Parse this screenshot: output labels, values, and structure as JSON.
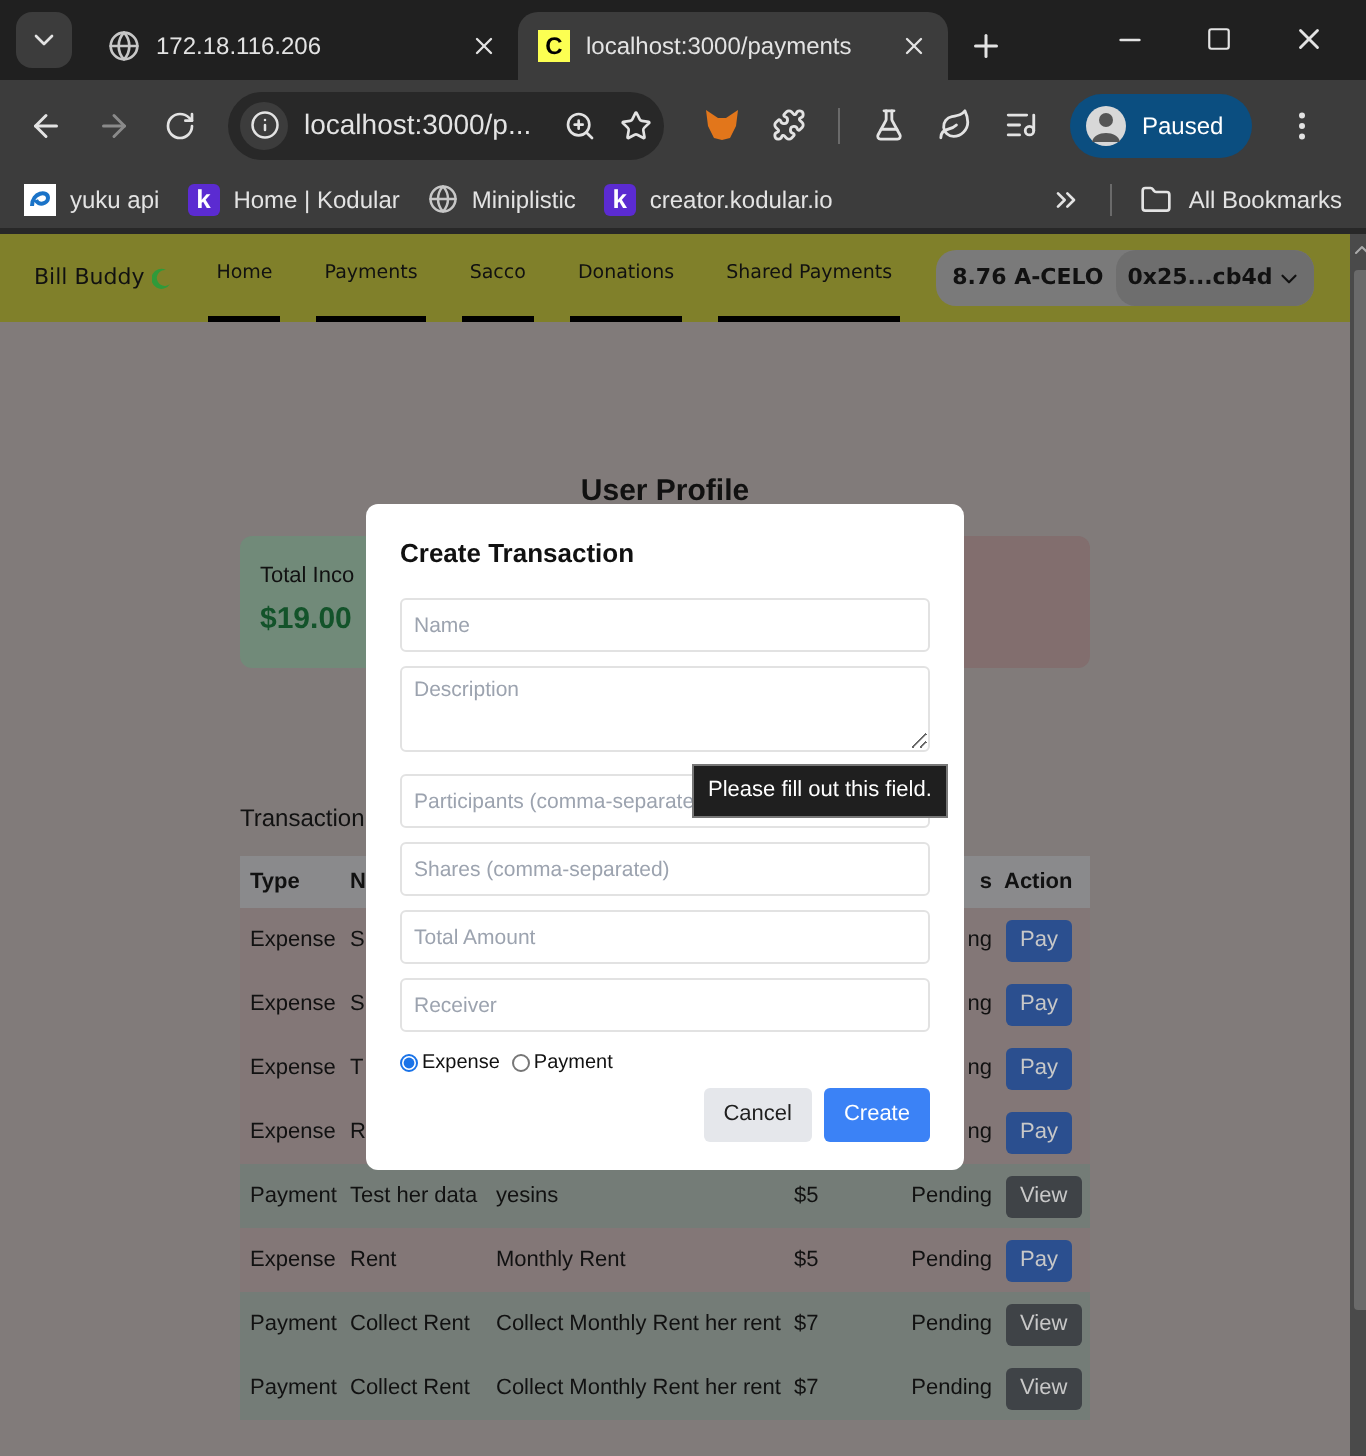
{
  "browser": {
    "tabs": [
      {
        "title": "172.18.116.206",
        "selected": false,
        "kind": "globe"
      },
      {
        "title": "localhost:3000/payments",
        "selected": true,
        "kind": "letter",
        "letter": "C"
      }
    ],
    "address": "localhost:3000/p...",
    "profile": "Paused",
    "bookmarks": [
      {
        "label": "yuku api",
        "kind": "yuku"
      },
      {
        "label": "Home | Kodular",
        "kind": "letter",
        "letter": "k"
      },
      {
        "label": "Miniplistic",
        "kind": "globe"
      },
      {
        "label": "creator.kodular.io",
        "kind": "letter",
        "letter": "k"
      }
    ],
    "all_bookmarks": "All Bookmarks"
  },
  "app": {
    "brand": "Bill Buddy",
    "nav": [
      "Home",
      "Payments",
      "Sacco",
      "Donations",
      "Shared Payments"
    ],
    "wallet": {
      "balance": "8.76 A-CELO",
      "address": "0x25...cb4d"
    }
  },
  "page": {
    "title": "User Profile",
    "cards": [
      {
        "label": "Total Inco",
        "value": "$19.00",
        "color": "#718a79"
      },
      {
        "color": "#826e6e"
      }
    ],
    "transactions_title": "Transaction",
    "table": {
      "header": {
        "type": "Type",
        "name": "N",
        "status": "s",
        "action": "Action"
      },
      "rows": [
        {
          "kind": "expense",
          "type": "Expense",
          "name": "S",
          "status": "ng",
          "action": "Pay"
        },
        {
          "kind": "expense",
          "type": "Expense",
          "name": "S",
          "status": "ng",
          "action": "Pay"
        },
        {
          "kind": "expense",
          "type": "Expense",
          "name": "T",
          "status": "ng",
          "action": "Pay"
        },
        {
          "kind": "expense",
          "type": "Expense",
          "name": "R",
          "status": "ng",
          "action": "Pay"
        },
        {
          "kind": "payment",
          "type": "Payment",
          "name": "Test her data",
          "description": "yesins",
          "amount": "$5",
          "status": "Pending",
          "action": "View"
        },
        {
          "kind": "expense",
          "type": "Expense",
          "name": "Rent",
          "description": "Monthly Rent",
          "amount": "$5",
          "status": "Pending",
          "action": "Pay"
        },
        {
          "kind": "payment",
          "type": "Payment",
          "name": "Collect Rent",
          "description": "Collect Monthly Rent her rent",
          "amount": "$7",
          "status": "Pending",
          "action": "View"
        },
        {
          "kind": "payment",
          "type": "Payment",
          "name": "Collect Rent",
          "description": "Collect Monthly Rent her rent",
          "amount": "$7",
          "status": "Pending",
          "action": "View"
        }
      ]
    }
  },
  "modal": {
    "title": "Create Transaction",
    "fields": [
      {
        "kind": "input",
        "placeholder": "Name"
      },
      {
        "kind": "textarea",
        "placeholder": "Description"
      },
      {
        "kind": "input",
        "placeholder": "Participants (comma-separate"
      },
      {
        "kind": "input",
        "placeholder": "Shares (comma-separated)"
      },
      {
        "kind": "input",
        "placeholder": "Total Amount"
      },
      {
        "kind": "input",
        "placeholder": "Receiver"
      }
    ],
    "types": [
      {
        "label": "Expense",
        "selected": true
      },
      {
        "label": "Payment",
        "selected": false
      }
    ],
    "buttons": [
      {
        "label": "Cancel",
        "kind": "secondary"
      },
      {
        "label": "Create",
        "kind": "primary"
      }
    ],
    "tooltip": "Please fill out this field."
  }
}
